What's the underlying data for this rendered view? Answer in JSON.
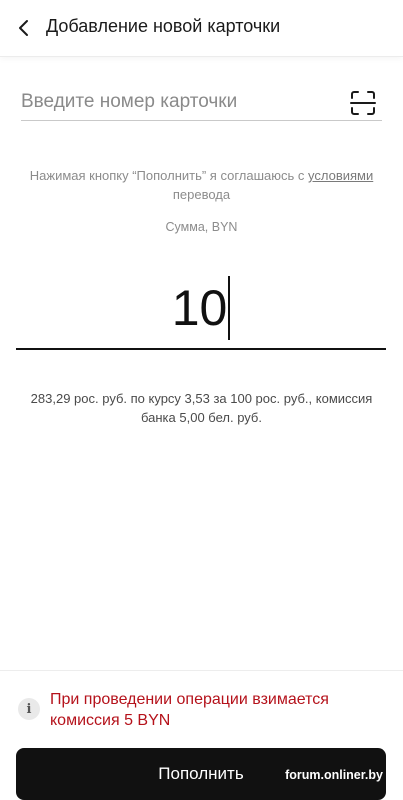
{
  "header": {
    "title": "Добавление новой карточки",
    "back_icon": "chevron-left-icon"
  },
  "card_input": {
    "placeholder": "Введите номер карточки",
    "value": "",
    "scan_icon": "scan-frame-icon"
  },
  "terms": {
    "prefix": "Нажимая кнопку “Пополнить” я соглашаюсь с ",
    "link": "условиями",
    "suffix": " перевода"
  },
  "amount": {
    "label": "Сумма, BYN",
    "value": "10"
  },
  "conversion_text": "283,29 рос. руб. по курсу 3,53 за 100 рос. руб., комиссия банка 5,00 бел. руб.",
  "warning": {
    "icon": "info-icon",
    "text": "При проведении операции взимается комиссия 5 BYN"
  },
  "submit_label": "Пополнить",
  "watermark": "forum.onliner.by",
  "colors": {
    "accent": "#111111",
    "warning": "#b5121b",
    "muted": "#8c8c8c"
  }
}
